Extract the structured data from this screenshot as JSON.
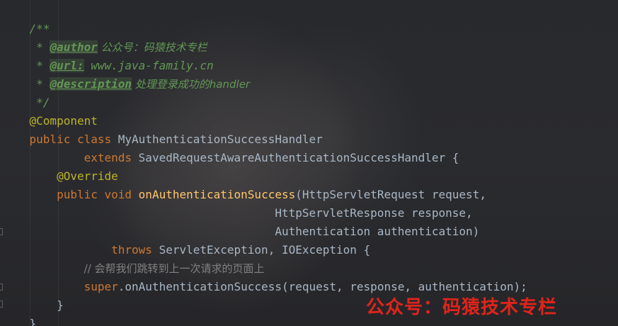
{
  "code": {
    "line1": {
      "text": "/**"
    },
    "line2": {
      "prefix": " * ",
      "tag": "@author",
      "text": " 公众号：码猿技术专栏"
    },
    "line3": {
      "prefix": " * ",
      "tag": "@url:",
      "text": " www.java-family.cn"
    },
    "line4": {
      "prefix": " * ",
      "tag": "@description",
      "text": " 处理登录成功的handler"
    },
    "line5": {
      "text": " */"
    },
    "line6": {
      "annotation": "@Component"
    },
    "line7": {
      "kw1": "public",
      "kw2": "class",
      "name": "MyAuthenticationSuccessHandler"
    },
    "line8": {
      "indent": "        ",
      "kw": "extends",
      "name": "SavedRequestAwareAuthenticationSuccessHandler {"
    },
    "line9": {
      "indent": "    ",
      "annotation": "@Override"
    },
    "line10": {
      "indent": "    ",
      "kw1": "public",
      "kw2": "void",
      "fn": "onAuthenticationSuccess",
      "params": "(HttpServletRequest request,"
    },
    "line11": {
      "indent": "                                    ",
      "params": "HttpServletResponse response,"
    },
    "line12": {
      "indent": "                                    ",
      "params": "Authentication authentication)"
    },
    "line13": {
      "indent": "            ",
      "kw": "throws",
      "rest": "ServletException, IOException {"
    },
    "line14": {
      "indent": "        ",
      "comment": "// 会帮我们跳转到上一次请求的页面上"
    },
    "line15": {
      "indent": "        ",
      "kw": "super",
      "rest": ".onAuthenticationSuccess(request, response, authentication);"
    },
    "line16": {
      "text": "    }"
    },
    "line17": {
      "text": "}"
    }
  },
  "watermark": {
    "text": "公众号：码猿技术专栏"
  },
  "colors": {
    "keyword": "#cc7832",
    "annotation": "#bbb529",
    "method": "#ffc66d",
    "plain": "#a9b7c6",
    "doc": "#629755",
    "comment": "#808080",
    "watermark": "#e0241b"
  }
}
